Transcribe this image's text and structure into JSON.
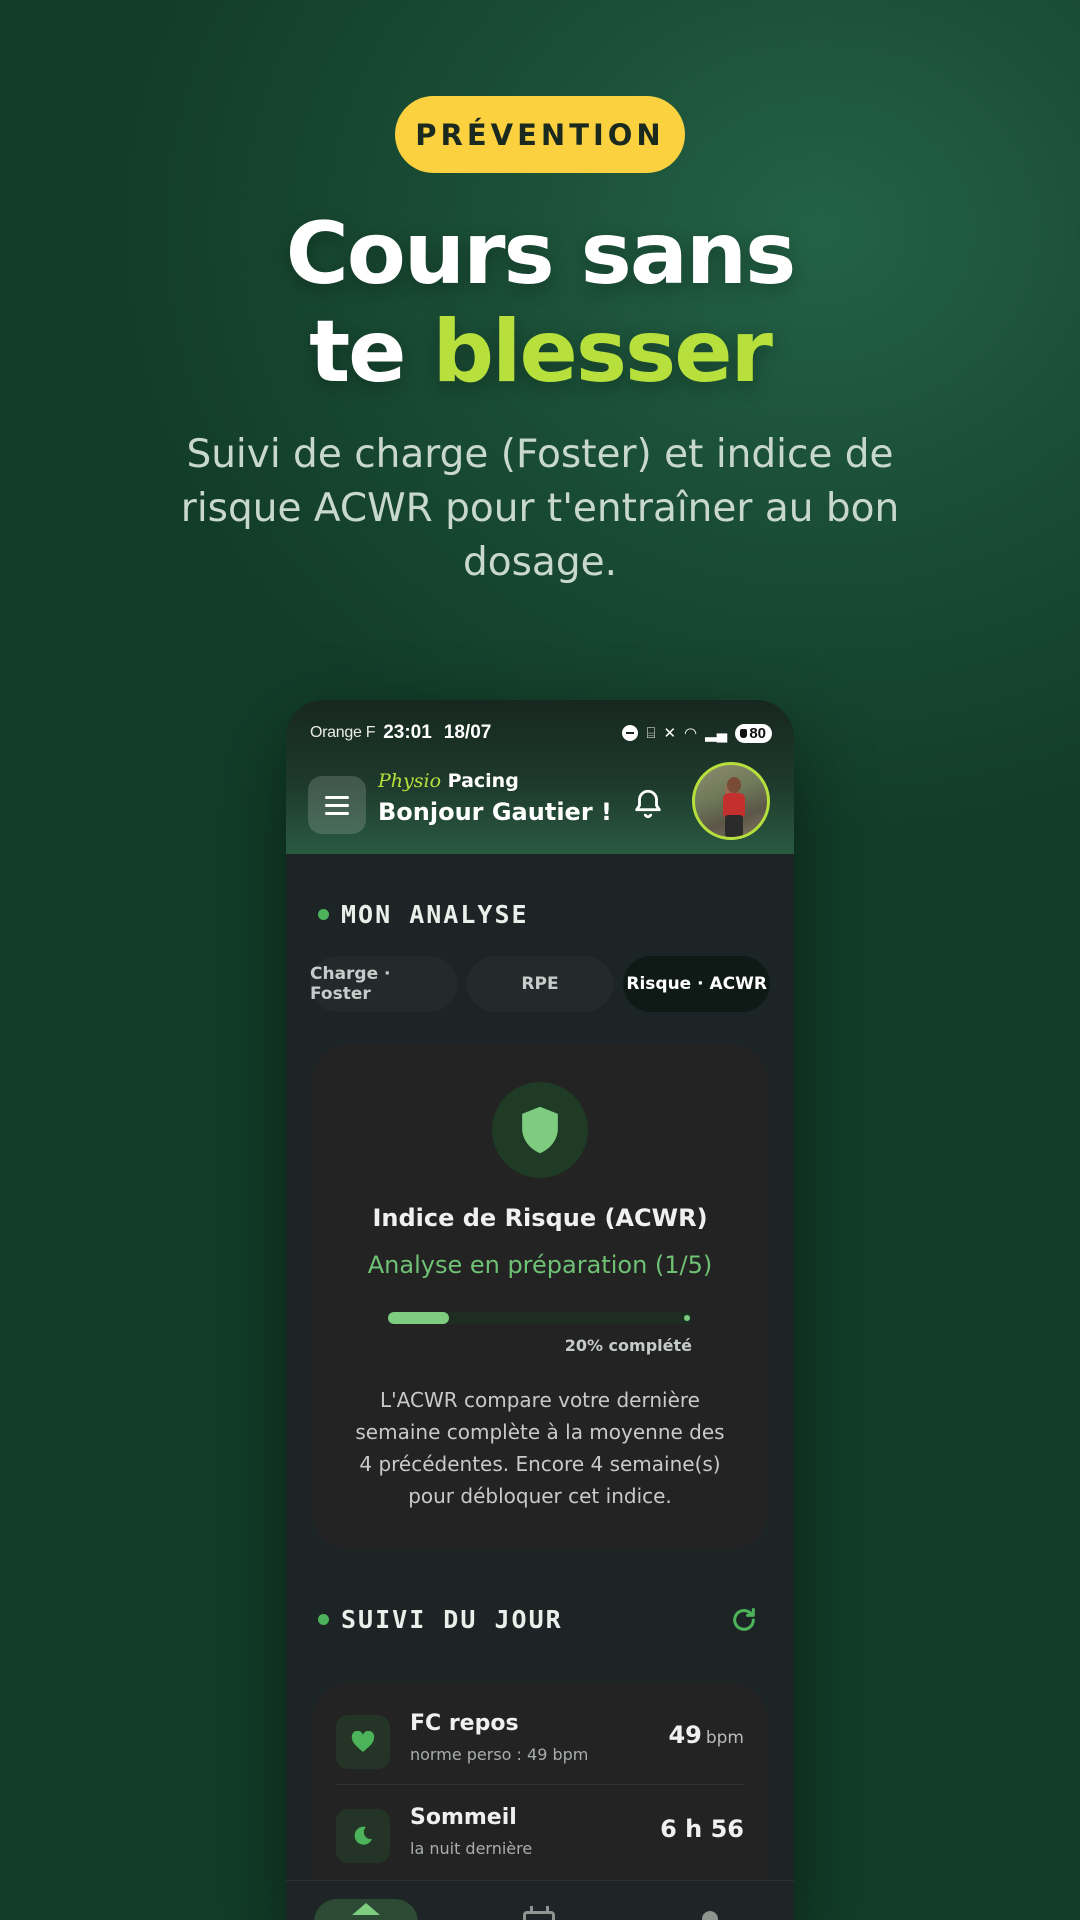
{
  "hero": {
    "badge": "PRÉVENTION",
    "title_line1": "Cours sans",
    "title_line2_plain": "te ",
    "title_line2_accent": "blesser",
    "subtitle": "Suivi de charge (Foster) et indice de risque ACWR pour t'entraîner au bon dosage."
  },
  "status_bar": {
    "carrier": "Orange F",
    "time": "23:01",
    "date": "18/07",
    "battery": "80"
  },
  "header": {
    "brand_part1": "Physio",
    "brand_part2": "Pacing",
    "greeting": "Bonjour Gautier !"
  },
  "analysis": {
    "section_title": "MON ANALYSE",
    "tabs": [
      {
        "label": "Charge · Foster",
        "active": false
      },
      {
        "label": "RPE",
        "active": false
      },
      {
        "label": "Risque · ACWR",
        "active": true
      }
    ],
    "card": {
      "title": "Indice de Risque (ACWR)",
      "status": "Analyse en préparation (1/5)",
      "progress_fraction": 0.2,
      "progress_label": "20% complété",
      "description": "L'ACWR compare votre dernière semaine complète à la moyenne des 4 précédentes. Encore 4 semaine(s) pour débloquer cet indice."
    }
  },
  "daily": {
    "section_title": "SUIVI DU JOUR",
    "metrics": [
      {
        "title": "FC repos",
        "subtitle": "norme perso : 49 bpm",
        "value": "49",
        "unit": "bpm",
        "icon": "heart-icon"
      },
      {
        "title": "Sommeil",
        "subtitle": "la nuit dernière",
        "value": "6 h 56",
        "unit": "",
        "icon": "moon-icon"
      }
    ]
  },
  "colors": {
    "accent_lime": "#b8e03c",
    "badge_yellow": "#fbd140",
    "success_green": "#6fc174"
  }
}
